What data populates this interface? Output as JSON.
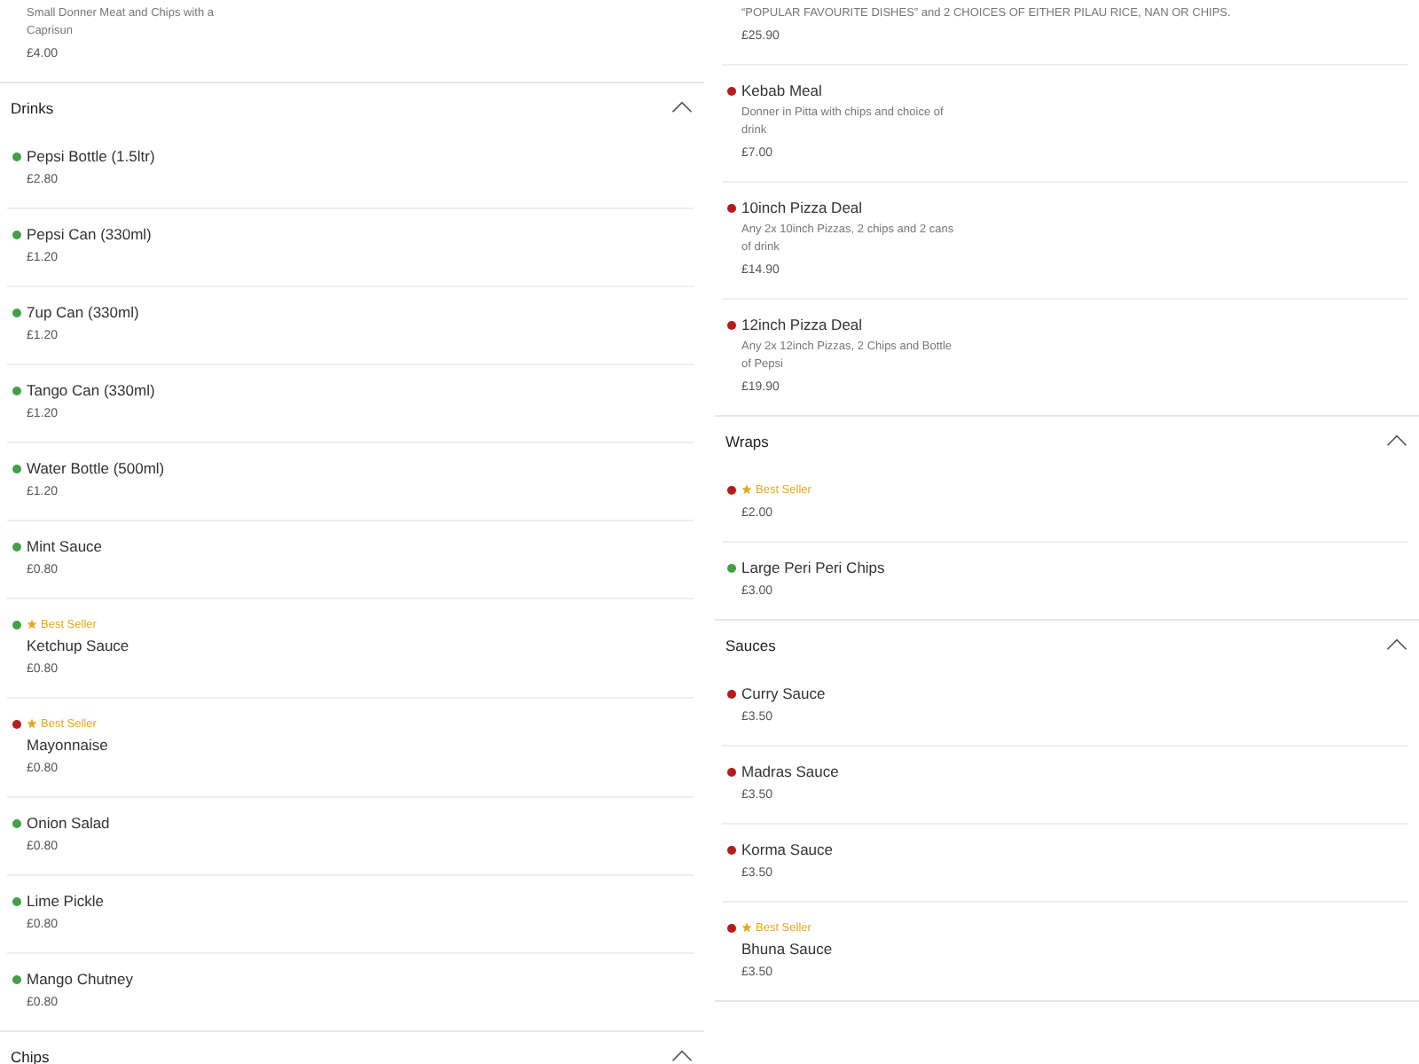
{
  "columns": [
    {
      "sections": [
        {
          "items": [
            {
              "description": "Small Donner Meat and Chips with a Caprisun",
              "price": "£4.00"
            }
          ]
        },
        {
          "heading": "Drinks",
          "expanded": true,
          "items": [
            {
              "name": "Pepsi Bottle (1.5ltr)",
              "price": "£2.80",
              "color": "#43a047"
            },
            {
              "name": "Pepsi Can (330ml)",
              "price": "£1.20",
              "color": "#43a047"
            },
            {
              "name": "7up Can (330ml)",
              "price": "£1.20",
              "color": "#43a047"
            },
            {
              "name": "Tango Can (330ml)",
              "price": "£1.20",
              "color": "#43a047"
            },
            {
              "name": "Water Bottle (500ml)",
              "price": "£1.20",
              "color": "#43a047"
            },
            {
              "name": "Mint Sauce",
              "price": "£0.80",
              "color": "#43a047"
            },
            {
              "badge": "Best Seller",
              "name": "Ketchup Sauce",
              "price": "£0.80",
              "color": "#43a047"
            },
            {
              "badge": "Best Seller",
              "name": "Mayonnaise",
              "price": "£0.80",
              "color": "#b71c1c"
            },
            {
              "name": "Onion Salad",
              "price": "£0.80",
              "color": "#43a047"
            },
            {
              "name": "Lime Pickle",
              "price": "£0.80",
              "color": "#43a047"
            },
            {
              "name": "Mango Chutney",
              "price": "£0.80",
              "color": "#43a047"
            }
          ]
        },
        {
          "heading": "Chips",
          "expanded": true
        }
      ]
    },
    {
      "sections": [
        {
          "items": [
            {
              "description": "“POPULAR FAVOURITE DISHES” and 2 CHOICES OF EITHER PILAU RICE, NAN OR CHIPS.",
              "price": "£25.90"
            },
            {
              "name": "Kebab Meal",
              "description": "Donner in Pitta with chips and choice of drink",
              "price": "£7.00",
              "color": "#b71c1c"
            },
            {
              "name": "10inch Pizza Deal",
              "description": "Any 2x 10inch Pizzas, 2 chips and 2 cans of drink",
              "price": "£14.90",
              "color": "#b71c1c"
            },
            {
              "name": "12inch Pizza Deal",
              "description": "Any 2x 12inch Pizzas, 2 Chips and Bottle of Pepsi",
              "price": "£19.90",
              "color": "#b71c1c"
            }
          ]
        },
        {
          "heading": "Wraps",
          "expanded": true,
          "items": [
            {
              "badge": "Best Seller",
              "price": "£2.00",
              "color": "#b71c1c"
            },
            {
              "name": "Large Peri Peri Chips",
              "price": "£3.00",
              "color": "#43a047"
            }
          ]
        },
        {
          "heading": "Sauces",
          "expanded": true,
          "items": [
            {
              "name": "Curry Sauce",
              "price": "£3.50",
              "color": "#b71c1c"
            },
            {
              "name": "Madras Sauce",
              "price": "£3.50",
              "color": "#b71c1c"
            },
            {
              "name": "Korma Sauce",
              "price": "£3.50",
              "color": "#b71c1c"
            },
            {
              "badge": "Best Seller",
              "name": "Bhuna Sauce",
              "price": "£3.50",
              "color": "#b71c1c"
            }
          ]
        }
      ]
    }
  ]
}
